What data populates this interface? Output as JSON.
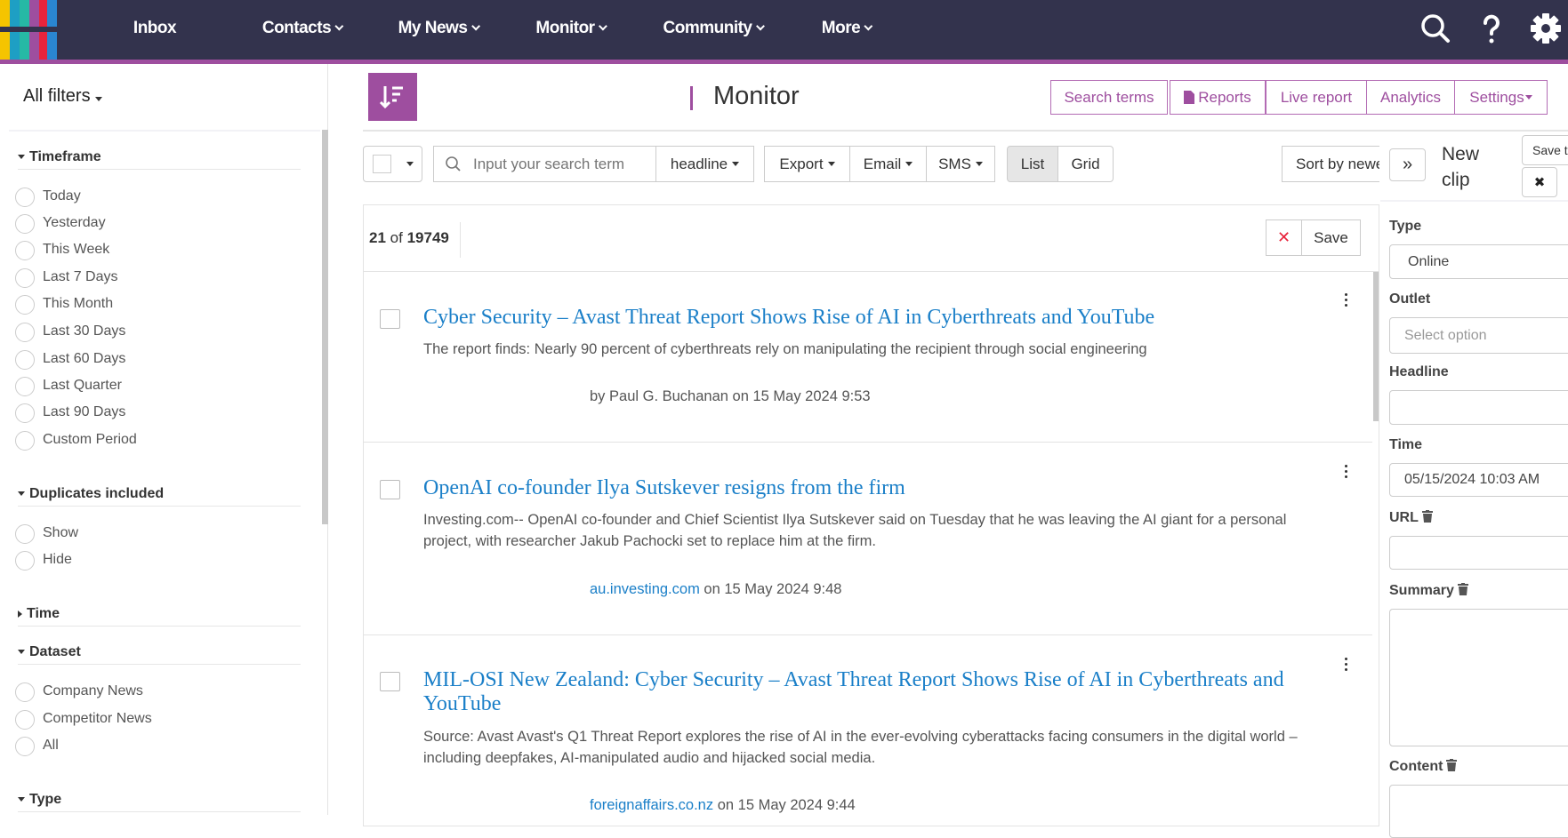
{
  "nav": {
    "items": [
      {
        "label": "Inbox",
        "dropdown": false
      },
      {
        "label": "Contacts",
        "dropdown": true
      },
      {
        "label": "My News",
        "dropdown": true
      },
      {
        "label": "Monitor",
        "dropdown": true
      },
      {
        "label": "Community",
        "dropdown": true
      },
      {
        "label": "More",
        "dropdown": true
      }
    ],
    "icons": [
      "search-icon",
      "help-icon",
      "gear-icon"
    ]
  },
  "colors": {
    "topbar": "#33334d",
    "accent": "#9e4e9f",
    "link": "#1a7fc8"
  },
  "sidebar": {
    "title": "All filters",
    "timeframe": {
      "label": "Timeframe",
      "options": [
        "Today",
        "Yesterday",
        "This Week",
        "Last 7 Days",
        "This Month",
        "Last 30 Days",
        "Last 60 Days",
        "Last Quarter",
        "Last 90 Days",
        "Custom Period"
      ]
    },
    "duplicates": {
      "label": "Duplicates included",
      "options": [
        "Show",
        "Hide"
      ]
    },
    "time": {
      "label": "Time"
    },
    "dataset": {
      "label": "Dataset",
      "options": [
        "Company News",
        "Competitor News",
        "All"
      ]
    },
    "type": {
      "label": "Type"
    }
  },
  "header": {
    "title": "Monitor",
    "buttons": {
      "search_terms": "Search terms",
      "reports": "Reports",
      "live_report": "Live report",
      "analytics": "Analytics",
      "settings": "Settings"
    }
  },
  "toolbar": {
    "search_placeholder": "Input your search term",
    "field": "headline",
    "export": "Export",
    "email": "Email",
    "sms": "SMS",
    "list": "List",
    "grid": "Grid",
    "sort": "Sort by newest"
  },
  "results": {
    "shown": "21",
    "of": "of",
    "total": "19749",
    "save": "Save",
    "clear": "✕"
  },
  "articles": [
    {
      "title": "Cyber Security – Avast Threat Report Shows Rise of AI in Cyberthreats and YouTube",
      "summary": "The report finds: Nearly 90 percent of cyberthreats rely on manipulating the recipient through social engineering",
      "by": "by Paul G. Buchanan",
      "source": "",
      "date": "on 15 May 2024 9:53"
    },
    {
      "title": "OpenAI co-founder Ilya Sutskever resigns from the firm",
      "summary": "Investing.com-- OpenAI co-founder and Chief Scientist Ilya Sutskever said on Tuesday that he was leaving the AI giant for a personal project, with researcher Jakub Pachocki set to replace him at the firm.",
      "by": "",
      "source": "au.investing.com",
      "date": "on 15 May 2024 9:48"
    },
    {
      "title": "MIL-OSI New Zealand: Cyber Security – Avast Threat Report Shows Rise of AI in Cyberthreats and YouTube",
      "summary": "Source: Avast Avast's Q1 Threat Report explores the rise of AI in the ever-evolving cyberattacks facing consumers in the digital world – including deepfakes, AI-manipulated audio and hijacked social media.",
      "by": "",
      "source": "foreignaffairs.co.nz",
      "date": "on 15 May 2024 9:44"
    }
  ],
  "clip": {
    "title_line1": "New",
    "title_line2": "clip",
    "save": "Save to",
    "expand": "»",
    "close": "✖",
    "fields": {
      "type_label": "Type",
      "type_value": "Online",
      "outlet_label": "Outlet",
      "outlet_placeholder": "Select option",
      "headline_label": "Headline",
      "time_label": "Time",
      "time_value": "05/15/2024 10:03 AM",
      "url_label": "URL",
      "summary_label": "Summary",
      "content_label": "Content"
    }
  }
}
